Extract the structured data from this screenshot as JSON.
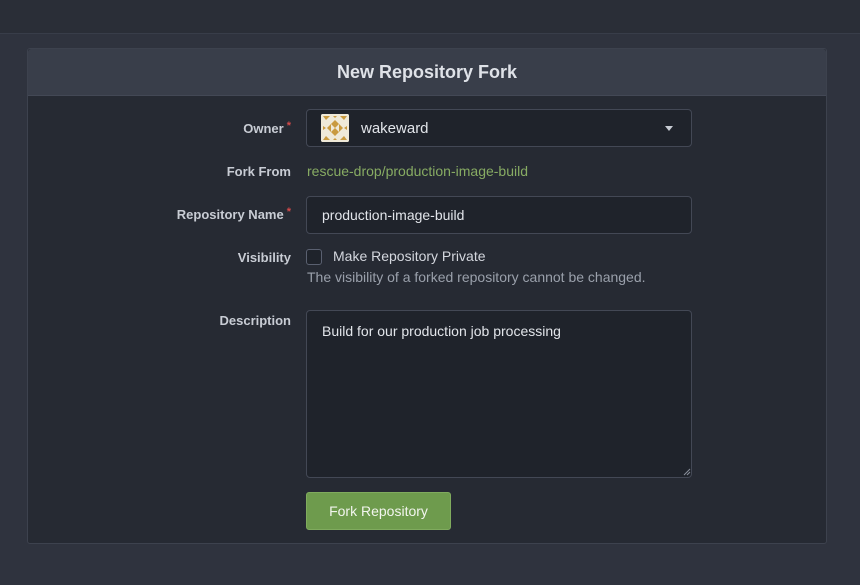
{
  "form": {
    "title": "New Repository Fork",
    "owner": {
      "label": "Owner",
      "required_mark": "*",
      "value": "wakeward"
    },
    "fork_from": {
      "label": "Fork From",
      "value": "rescue-drop/production-image-build"
    },
    "repo_name": {
      "label": "Repository Name",
      "required_mark": "*",
      "value": "production-image-build"
    },
    "visibility": {
      "label": "Visibility",
      "checkbox_label": "Make Repository Private",
      "help": "The visibility of a forked repository cannot be changed."
    },
    "description": {
      "label": "Description",
      "value": "Build for our production job processing"
    },
    "submit_label": "Fork Repository"
  },
  "colors": {
    "accent": "#6e9b4d",
    "link": "#87ab63",
    "required": "#d34a4a"
  },
  "icons": {
    "avatar": "identicon-avatar",
    "dropdown": "caret-down-icon"
  }
}
